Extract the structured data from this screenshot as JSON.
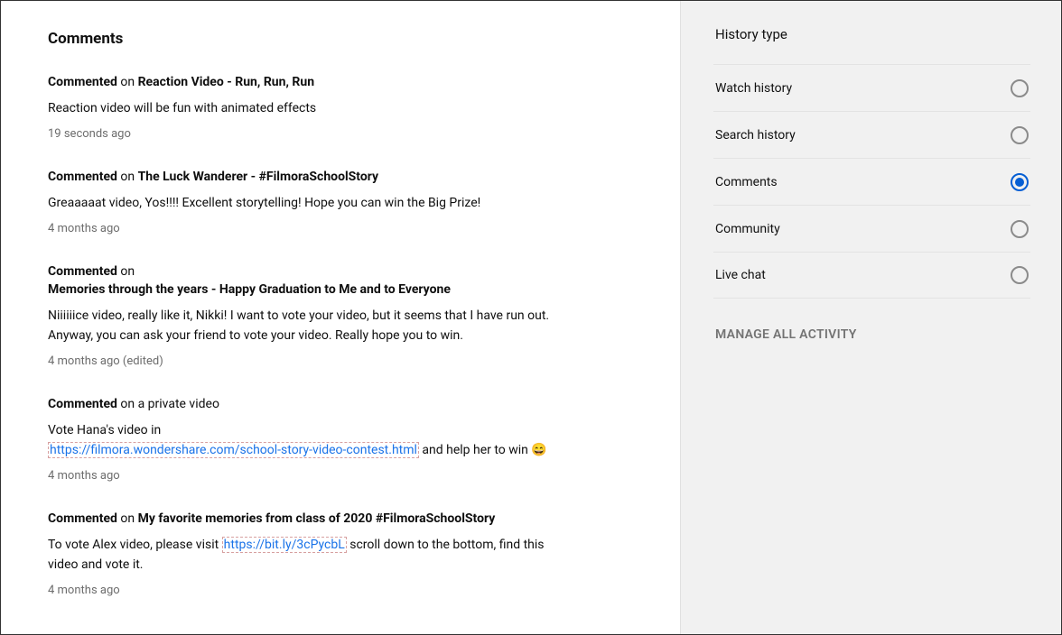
{
  "main": {
    "title": "Comments",
    "items": [
      {
        "prefix": "Commented",
        "mid": " on ",
        "title": "Reaction Video - Run, Run, Run",
        "body_plain": "Reaction video will be fun with animated effects",
        "ts": "19 seconds ago"
      },
      {
        "prefix": "Commented",
        "mid": " on ",
        "title": "The Luck Wanderer - #FilmoraSchoolStory",
        "body_plain": "Greaaaaat video, Yos!!!! Excellent storytelling! Hope you can win the Big Prize!",
        "ts": "4 months ago"
      },
      {
        "prefix": "Commented",
        "mid": " on",
        "title": "Memories through the years - Happy Graduation to Me and to Everyone",
        "title_newline": true,
        "body_plain": "Niiiiiice video, really like it, Nikki! I want to vote your video, but it seems that I have run out. Anyway, you can ask your friend to vote your video. Really hope you to win.",
        "ts": "4 months ago (edited)"
      },
      {
        "prefix": "Commented",
        "mid": " on a private video",
        "title": "",
        "body_pre": "Vote Hana's video in ",
        "body_link": "https://filmora.wondershare.com/school-story-video-contest.html",
        "body_post": " and help her to win ",
        "emoji": "😄",
        "ts": "4 months ago"
      },
      {
        "prefix": "Commented",
        "mid": " on ",
        "title": "My favorite memories from class of 2020 #FilmoraSchoolStory",
        "body_pre": "To vote Alex video, please visit ",
        "body_link": "https://bit.ly/3cPycbL",
        "body_post": " scroll down to the bottom, find this video and vote it.",
        "ts": "4 months ago"
      }
    ]
  },
  "sidebar": {
    "title": "History type",
    "options": [
      {
        "label": "Watch history",
        "selected": false
      },
      {
        "label": "Search history",
        "selected": false
      },
      {
        "label": "Comments",
        "selected": true
      },
      {
        "label": "Community",
        "selected": false
      },
      {
        "label": "Live chat",
        "selected": false
      }
    ],
    "manage": "MANAGE ALL ACTIVITY"
  }
}
